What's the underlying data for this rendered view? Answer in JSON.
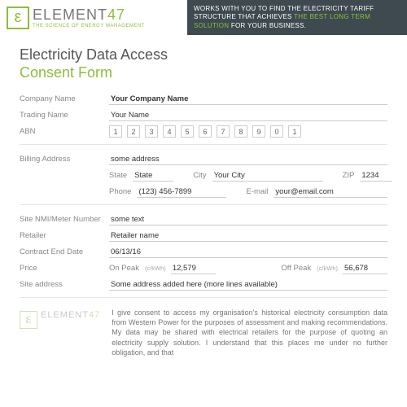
{
  "header": {
    "logo_word_a": "ELEMENT",
    "logo_word_b": "47",
    "logo_tagline": "THE SCIENCE OF ENERGY MANAGEMENT",
    "promo_a": "WORKS WITH YOU TO FIND THE ELECTRICITY TARIFF STRUCTURE THAT ACHIEVES ",
    "promo_hl": "THE BEST LONG TERM SOLUTION",
    "promo_b": " FOR YOUR BUSINESS."
  },
  "titles": {
    "t1": "Electricity Data Access",
    "t2": "Consent Form"
  },
  "labels": {
    "company": "Company Name",
    "trading": "Trading Name",
    "abn": "ABN",
    "billing": "Billing Address",
    "state": "State",
    "city": "City",
    "zip": "ZIP",
    "phone": "Phone",
    "email": "E-mail",
    "nmi": "Site NMI/Meter Number",
    "retailer": "Retailer",
    "contract_end": "Contract End Date",
    "price": "Price",
    "on_peak": "On Peak",
    "off_peak": "Off Peak",
    "unit": "(c/kWh)",
    "site_addr": "Site address"
  },
  "values": {
    "company": "Your Company Name",
    "trading": "Your Name",
    "abn": [
      "1",
      "2",
      "3",
      "4",
      "5",
      "6",
      "7",
      "8",
      "9",
      "0",
      "1"
    ],
    "billing": "some address",
    "state": "State",
    "city": "Your City",
    "zip": "1234",
    "phone": "(123) 456-7899",
    "email": "your@email.com",
    "nmi": "some text",
    "retailer": "Retailer name",
    "contract_end": "06/13/16",
    "on_peak": "12,579",
    "off_peak": "56,678",
    "site_addr": "Some address added here (more lines available)"
  },
  "consent": "I give consent to access my organisation's historical electricity consumption data from Western Power for the purposes of assessment and making recommendations. My data may be shared with electrical retailers for the purpose of quoting an electricity supply solution. I understand that this places me under no further obligation, and that"
}
